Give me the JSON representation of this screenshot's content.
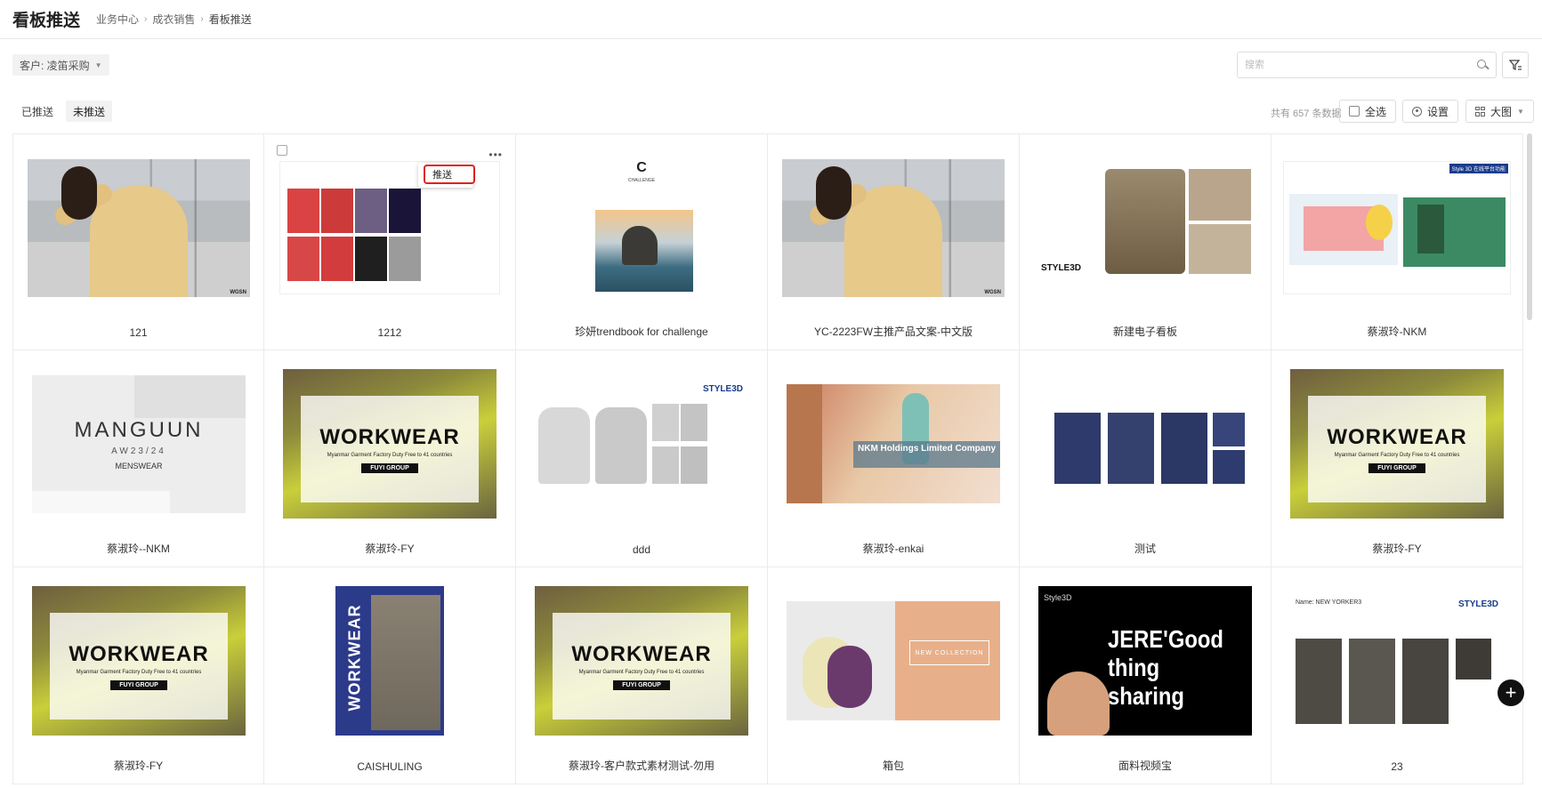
{
  "header": {
    "title": "看板推送",
    "breadcrumb": [
      "业务中心",
      "成衣销售",
      "看板推送"
    ]
  },
  "filter": {
    "customer_label": "客户: 凌笛采购",
    "search_placeholder": "搜索"
  },
  "tabs": [
    {
      "label": "已推送",
      "active": false
    },
    {
      "label": "未推送",
      "active": true
    }
  ],
  "toolbar": {
    "total": "共有 657 条数据",
    "select_all": "全选",
    "settings": "设置",
    "view_mode": "大图"
  },
  "card_menu": {
    "push": "推送"
  },
  "cards": [
    {
      "name": "121",
      "art": "woman"
    },
    {
      "name": "1212",
      "art": "board"
    },
    {
      "name": "珍妍trendbook for challenge",
      "art": "challenge"
    },
    {
      "name": "YC-2223FW主推产品文案-中文版",
      "art": "woman"
    },
    {
      "name": "新建电子看板",
      "art": "hat"
    },
    {
      "name": "蔡淑玲-NKM",
      "art": "style3d"
    },
    {
      "name": "蔡淑玲--NKM",
      "art": "manguun"
    },
    {
      "name": "蔡淑玲-FY",
      "art": "workwear"
    },
    {
      "name": "ddd",
      "art": "hoodie"
    },
    {
      "name": "蔡淑玲-enkai",
      "art": "nkm"
    },
    {
      "name": "测试",
      "art": "dress"
    },
    {
      "name": "蔡淑玲-FY",
      "art": "workwear"
    },
    {
      "name": "蔡淑玲-FY",
      "art": "workwear"
    },
    {
      "name": "CAISHULING",
      "art": "pants"
    },
    {
      "name": "蔡淑玲-客户款式素材测试-勿用",
      "art": "workwear"
    },
    {
      "name": "箱包",
      "art": "bags"
    },
    {
      "name": "面料视频宝",
      "art": "jere"
    },
    {
      "name": "23",
      "art": "coats"
    }
  ],
  "art_text": {
    "wgsn": "WGSN",
    "challenge": "CHALLENGE",
    "style3d": "STYLE3D",
    "manguun": "MANGUUN",
    "manguun_season": "AW23/24",
    "manguun_sub": "MENSWEAR",
    "workwear_title": "WORKWEAR",
    "workwear_sub": "Myanmar Garment Factory Duty Free to 41 countries",
    "workwear_btn": "FUYI GROUP",
    "nkm_text": "NKM Holdings Limited Company",
    "pants_vertical": "WORKWEAR",
    "new_collection": "NEW COLLECTION",
    "jere_text": "JERE'Good thing sharing",
    "jere_brand": "Style3D",
    "style3d_banner": "Style 3D 在线平台功能",
    "coat_title": "Name:  NEW YORKER3"
  }
}
